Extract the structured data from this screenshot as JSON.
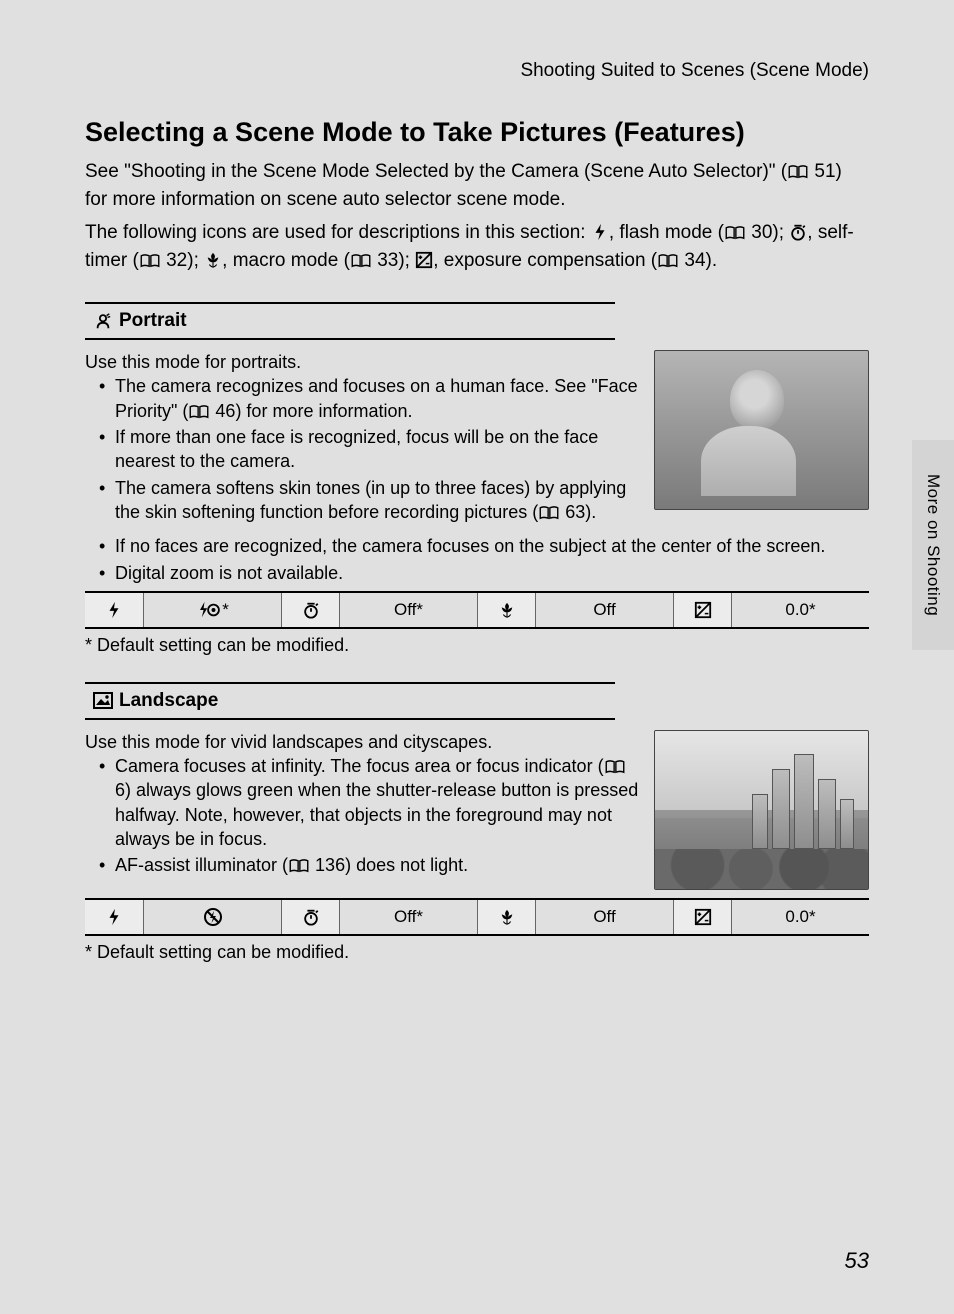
{
  "breadcrumb": "Shooting Suited to Scenes (Scene Mode)",
  "section_title": "Selecting a Scene Mode to Take Pictures (Features)",
  "intro": {
    "p1_a": "See \"Shooting in the Scene Mode Selected by the Camera (Scene Auto Selector)\" (",
    "p1_ref": "51",
    "p1_b": ") for more information on scene auto selector scene mode.",
    "p2_a": "The following icons are used for descriptions in this section: ",
    "p2_flash": ", flash mode (",
    "p2_ref1": "30",
    "p2_b": "); ",
    "p2_timer": ", self-timer (",
    "p2_ref2": "32",
    "p2_c": "); ",
    "p2_macro": ", macro mode (",
    "p2_ref3": "33",
    "p2_d": "); ",
    "p2_exp": ", exposure compensation (",
    "p2_ref4": "34",
    "p2_e": ")."
  },
  "side_tab": "More on Shooting",
  "page_number": "53",
  "portrait": {
    "heading": "Portrait",
    "desc": "Use this mode for portraits.",
    "b1_a": "The camera recognizes and focuses on a human face. See \"Face Priority\" (",
    "b1_ref": "46",
    "b1_b": ") for more information.",
    "b2": "If more than one face is recognized, focus will be on the face nearest to the camera.",
    "b3_a": "The camera softens skin tones (in up to three faces) by applying the skin softening function before recording pictures (",
    "b3_ref": "63",
    "b3_b": ").",
    "b4": "If no faces are recognized, the camera focuses on the subject at the center of the screen.",
    "b5": "Digital zoom is not available.",
    "table": {
      "flash_val": "*",
      "timer_val": "Off*",
      "macro_val": "Off",
      "exp_val": "0.0*"
    },
    "footnote": "*  Default setting can be modified."
  },
  "landscape": {
    "heading": "Landscape",
    "desc": "Use this mode for vivid landscapes and cityscapes.",
    "b1_a": "Camera focuses at infinity. The focus area or focus indicator (",
    "b1_ref": "6",
    "b1_b": ") always glows green when the shutter-release button is pressed halfway. Note, however, that objects in the foreground may not always be in focus.",
    "b2_a": "AF-assist illuminator (",
    "b2_ref": "136",
    "b2_b": ") does not light.",
    "table": {
      "flash_val": "",
      "timer_val": "Off*",
      "macro_val": "Off",
      "exp_val": "0.0*"
    },
    "footnote": "*  Default setting can be modified."
  }
}
